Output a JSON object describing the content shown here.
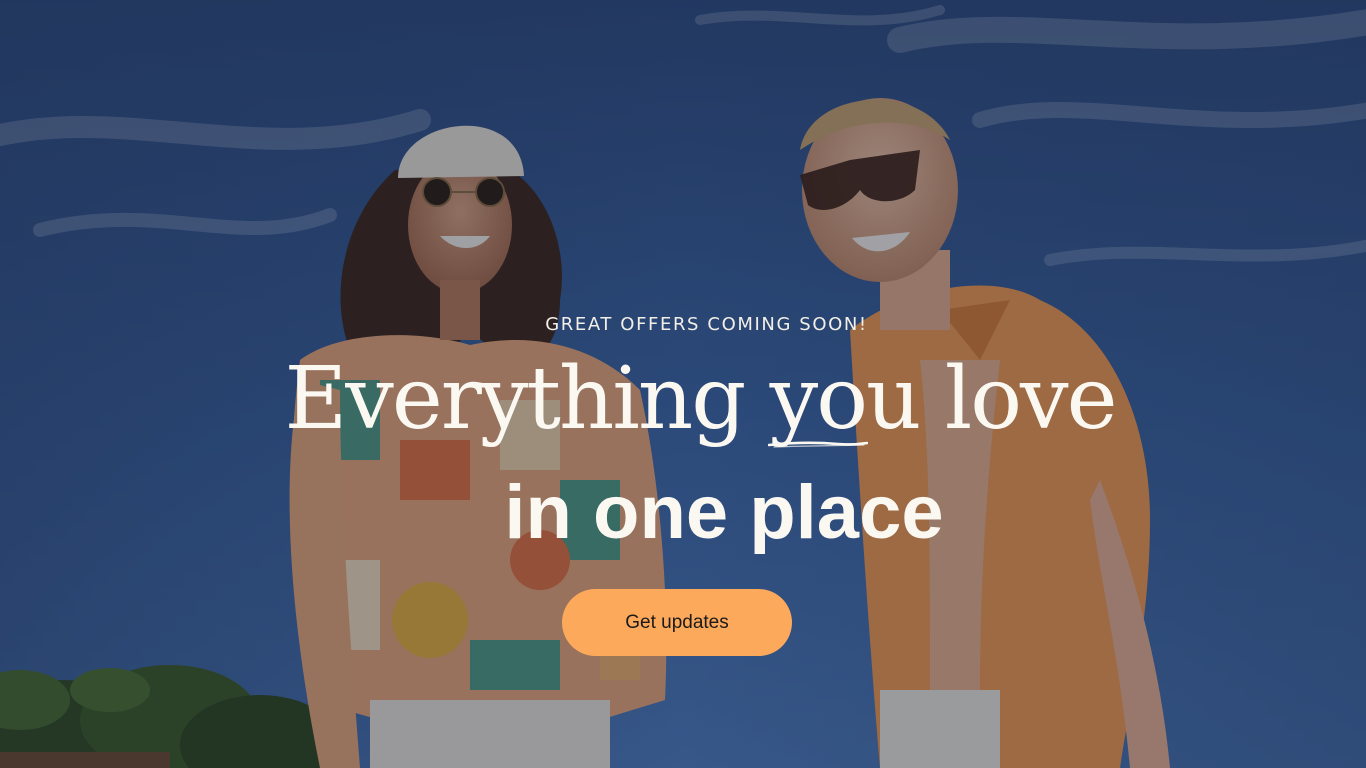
{
  "hero": {
    "eyebrow": "GREAT OFFERS COMING SOON!",
    "headline_line1_before": "Everything ",
    "headline_line1_emphasis": "you",
    "headline_line1_after": " love",
    "headline_line2": "in one place",
    "cta_label": "Get updates"
  },
  "colors": {
    "sky": "#2f4f86",
    "text": "#fbf8f2",
    "cta_background": "#fda95c",
    "cta_text": "#1c1a18"
  }
}
